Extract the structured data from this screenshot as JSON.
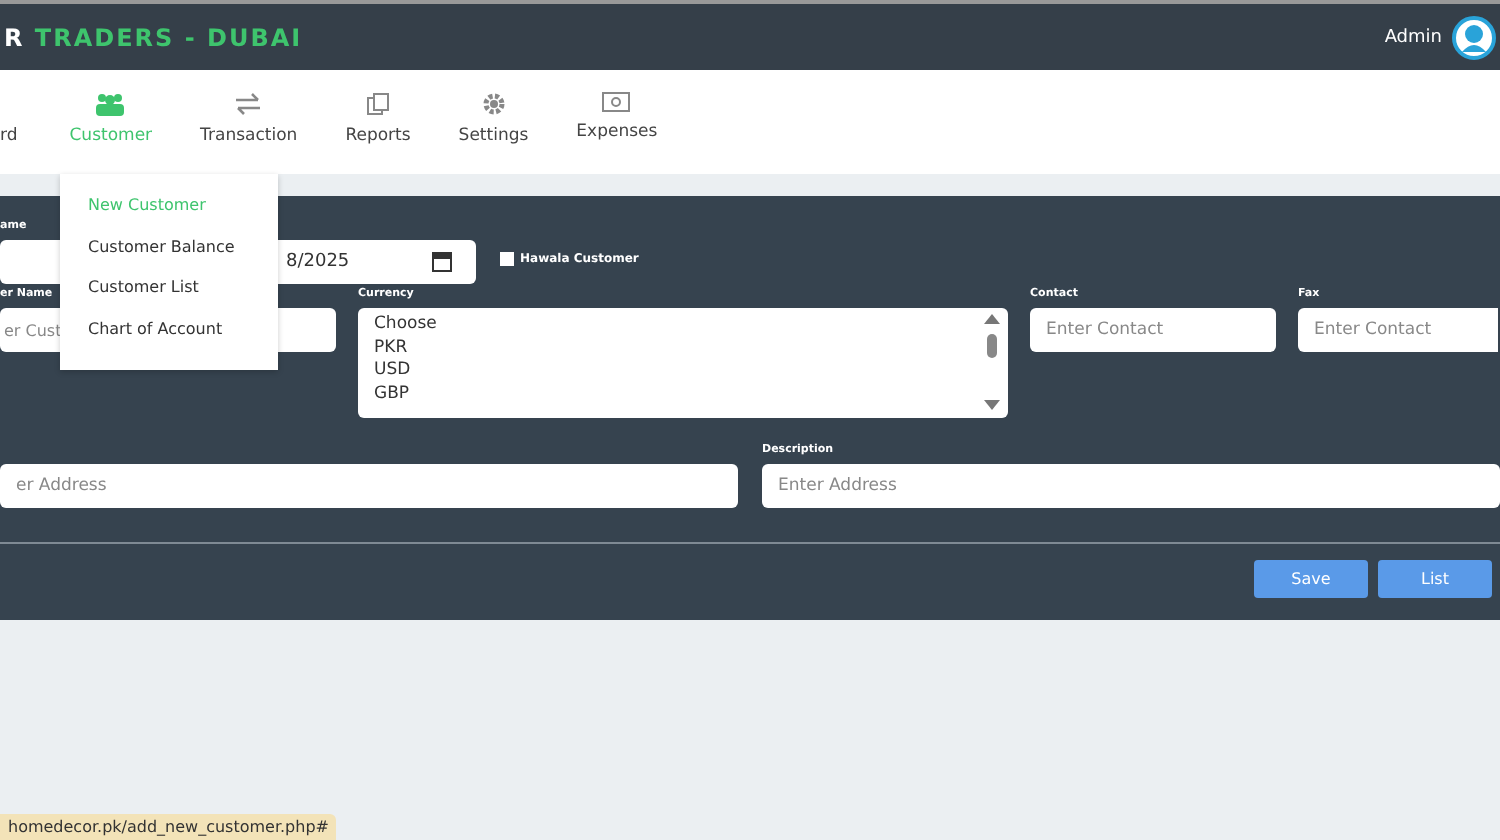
{
  "header": {
    "brand_prefix": "R",
    "brand": "TRADERS - DUBAI",
    "user": "Admin"
  },
  "nav": [
    {
      "label": "rd",
      "kind": "none",
      "selected": false
    },
    {
      "label": "Customer",
      "kind": "people",
      "selected": true
    },
    {
      "label": "Transaction",
      "kind": "arrows",
      "selected": false
    },
    {
      "label": "Reports",
      "kind": "copy",
      "selected": false
    },
    {
      "label": "Settings",
      "kind": "gear",
      "selected": false
    },
    {
      "label": "Expenses",
      "kind": "cash",
      "selected": false
    }
  ],
  "menu": [
    {
      "label": "New Customer",
      "selected": true
    },
    {
      "label": "Customer Balance",
      "selected": false
    },
    {
      "label": "Customer List",
      "selected": false
    },
    {
      "label": "Chart of Account",
      "selected": false
    }
  ],
  "form": {
    "date": {
      "label": "ame",
      "value": "8/2025"
    },
    "hawala": {
      "label": "Hawala Customer",
      "checked": false
    },
    "customer_name": {
      "label": "er Name",
      "placeholder": "er Cust"
    },
    "currency": {
      "label": "Currency",
      "options": [
        "Choose",
        "PKR",
        "USD",
        "GBP"
      ]
    },
    "contact": {
      "label": "Contact",
      "placeholder": "Enter Contact"
    },
    "fax": {
      "label": "Fax",
      "placeholder": "Enter Contact"
    },
    "address": {
      "placeholder": "er Address"
    },
    "description": {
      "label": "Description",
      "placeholder": "Enter Address"
    }
  },
  "buttons": [
    "Save",
    "List"
  ],
  "status_bar": "homedecor.pk/add_new_customer.php#"
}
